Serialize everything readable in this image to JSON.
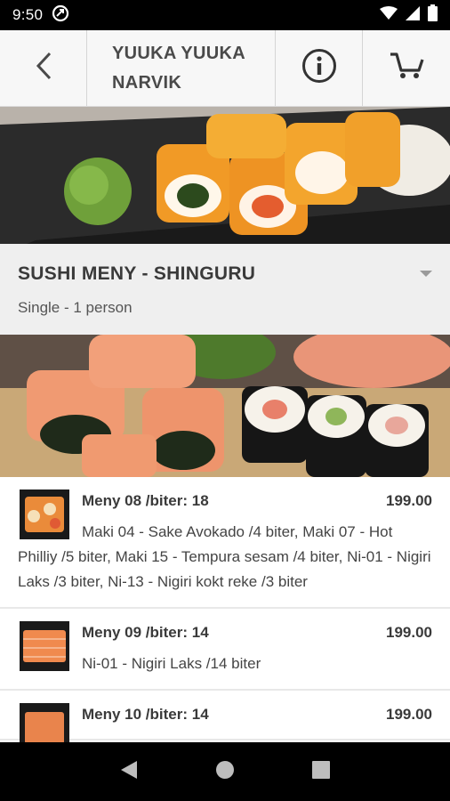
{
  "status_bar": {
    "time": "9:50"
  },
  "header": {
    "title": "YUUKA YUUKA\nNARVIK"
  },
  "section": {
    "title": "SUSHI MENY - SHINGURU",
    "subtitle": "Single - 1 person"
  },
  "menu": {
    "items": [
      {
        "name": "Meny 08 /biter: 18",
        "price": "199.00",
        "desc": "Maki 04 - Sake Avokado /4 biter, Maki 07 - Hot Philliy /5 biter, Maki 15 - Tempura sesam /4 biter, Ni-01 - Nigiri Laks /3 biter, Ni-13 - Nigiri kokt reke /3 biter"
      },
      {
        "name": "Meny 09 /biter: 14",
        "price": "199.00",
        "desc": "Ni-01 - Nigiri Laks /14 biter"
      },
      {
        "name": "Meny 10 /biter: 14",
        "price": "199.00",
        "desc": ""
      }
    ]
  }
}
